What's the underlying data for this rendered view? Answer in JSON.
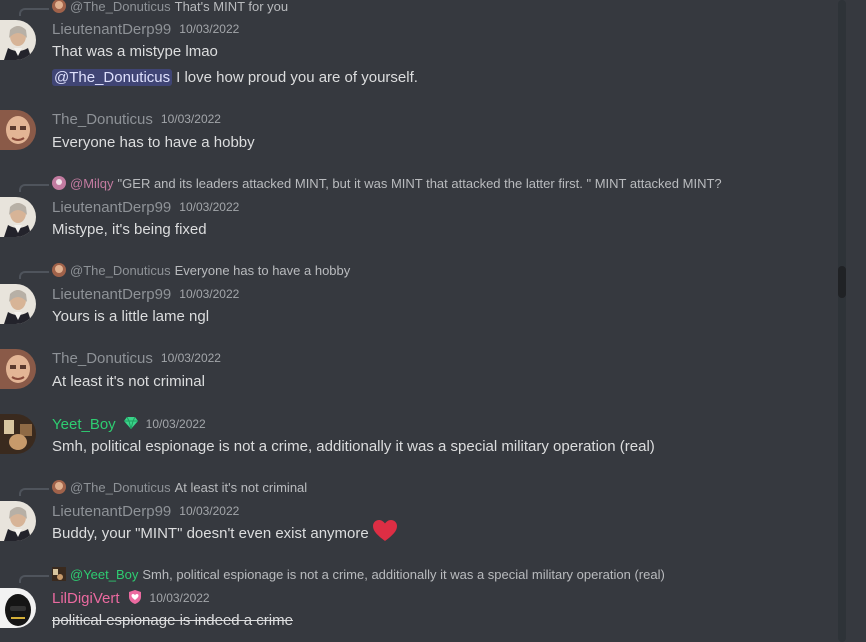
{
  "colors": {
    "background": "#36393f",
    "name_grey": "#8e9297",
    "name_green": "#2ecc71",
    "name_pink": "#eb6aa0",
    "text": "#dcddde",
    "mention_bg": "#414775"
  },
  "messages": [
    {
      "reply": {
        "name": "@The_Donuticus",
        "text": "That's MINT for you",
        "avatar_icon": "donuticus-avatar"
      },
      "username": "LieutenantDerp99",
      "timestamp": "10/03/2022",
      "lines": [
        "That was a mistype lmao",
        {
          "mention": "@The_Donuticus",
          "text": "I love how proud you are of yourself."
        }
      ],
      "avatar_icon": "hamilton-avatar"
    },
    {
      "username": "The_Donuticus",
      "timestamp": "10/03/2022",
      "lines": [
        "Everyone has to have a hobby"
      ],
      "avatar_icon": "donuticus-avatar"
    },
    {
      "reply": {
        "name": "@Milqy",
        "text": "\"GER and its leaders attacked MINT, but it was MINT that attacked the latter first. \" MINT attacked MINT?",
        "avatar_icon": "milqy-avatar"
      },
      "username": "LieutenantDerp99",
      "timestamp": "10/03/2022",
      "lines": [
        "Mistype, it's being fixed"
      ],
      "avatar_icon": "hamilton-avatar"
    },
    {
      "reply": {
        "name": "@The_Donuticus",
        "text": "Everyone has to have a hobby",
        "avatar_icon": "donuticus-avatar"
      },
      "username": "LieutenantDerp99",
      "timestamp": "10/03/2022",
      "lines": [
        "Yours is a little lame ngl"
      ],
      "avatar_icon": "hamilton-avatar"
    },
    {
      "username": "The_Donuticus",
      "timestamp": "10/03/2022",
      "lines": [
        "At least it's not criminal"
      ],
      "avatar_icon": "donuticus-avatar"
    },
    {
      "username": "Yeet_Boy",
      "badge_icon": "gem-icon",
      "timestamp": "10/03/2022",
      "lines": [
        "Smh, political espionage is not a crime, additionally it was a special military operation (real)"
      ],
      "avatar_icon": "yeetboy-avatar"
    },
    {
      "reply": {
        "name": "@The_Donuticus",
        "text": "At least it's not criminal",
        "avatar_icon": "donuticus-avatar"
      },
      "username": "LieutenantDerp99",
      "timestamp": "10/03/2022",
      "lines": [
        "Buddy, your \"MINT\" doesn't even exist anymore"
      ],
      "emoji_icon": "heart-emoji",
      "avatar_icon": "hamilton-avatar"
    },
    {
      "reply": {
        "name": "@Yeet_Boy",
        "text": "Smh, political espionage is not a crime, additionally it was a special military operation (real)",
        "avatar_icon": "yeetboy-avatar"
      },
      "username": "LilDigiVert",
      "badge_icon": "shield-heart-icon",
      "timestamp": "10/03/2022",
      "lines": [
        "political espionage is indeed a crime"
      ],
      "avatar_icon": "lildigivert-avatar"
    }
  ]
}
